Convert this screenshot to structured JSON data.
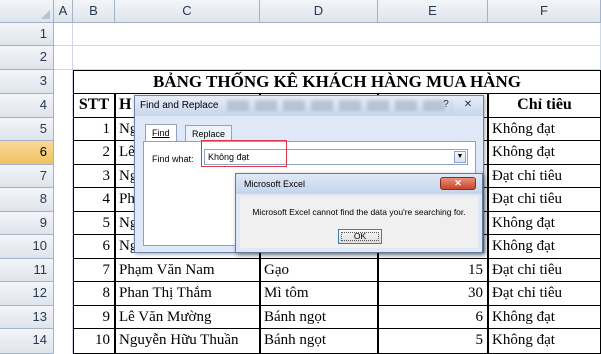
{
  "columns": [
    "A",
    "B",
    "C",
    "D",
    "E",
    "F"
  ],
  "rows": [
    "1",
    "2",
    "3",
    "4",
    "5",
    "6",
    "7",
    "8",
    "9",
    "10",
    "11",
    "12",
    "13",
    "14"
  ],
  "table": {
    "title": "BẢNG THỐNG KÊ KHÁCH HÀNG MUA HÀNG",
    "headers": {
      "stt": "STT",
      "name_partial": "H",
      "result": "Chỉ tiêu"
    },
    "rows": [
      {
        "stt": "1",
        "name": "Ng",
        "item": "",
        "qty": "",
        "result": "Không đạt"
      },
      {
        "stt": "2",
        "name": "Lê",
        "item": "",
        "qty": "",
        "result": "Không đạt"
      },
      {
        "stt": "3",
        "name": "Ng",
        "item": "",
        "qty": "",
        "result": "Đạt chỉ tiêu"
      },
      {
        "stt": "4",
        "name": "Ph",
        "item": "",
        "qty": "",
        "result": "Đạt chỉ tiêu"
      },
      {
        "stt": "5",
        "name": "Ng",
        "item": "",
        "qty": "",
        "result": "Không đạt"
      },
      {
        "stt": "6",
        "name": "Nguyễn Hữu Thuần",
        "item": "",
        "qty": "",
        "result": "Không đạt"
      },
      {
        "stt": "7",
        "name": "Phạm Văn Nam",
        "item": "Gạo",
        "qty": "15",
        "result": "Đạt chỉ tiêu"
      },
      {
        "stt": "8",
        "name": "Phan Thị Thắm",
        "item": "Mì tôm",
        "qty": "30",
        "result": "Đạt chỉ tiêu"
      },
      {
        "stt": "9",
        "name": "Lê Văn Mường",
        "item": "Bánh ngọt",
        "qty": "6",
        "result": "Không đạt"
      },
      {
        "stt": "10",
        "name": "Nguyễn Hữu Thuần",
        "item": "Bánh ngọt",
        "qty": "5",
        "result": "Không đạt"
      }
    ]
  },
  "find_replace": {
    "title": "Find and Replace",
    "tab_find": "Find",
    "tab_replace": "Replace",
    "find_what_label": "Find what:",
    "find_what_value": "Không đạt",
    "help": "?",
    "close": "✕"
  },
  "message_box": {
    "title": "Microsoft Excel",
    "message": "Microsoft Excel cannot find the data you're searching for.",
    "ok_label": "OK",
    "close": "✕"
  }
}
